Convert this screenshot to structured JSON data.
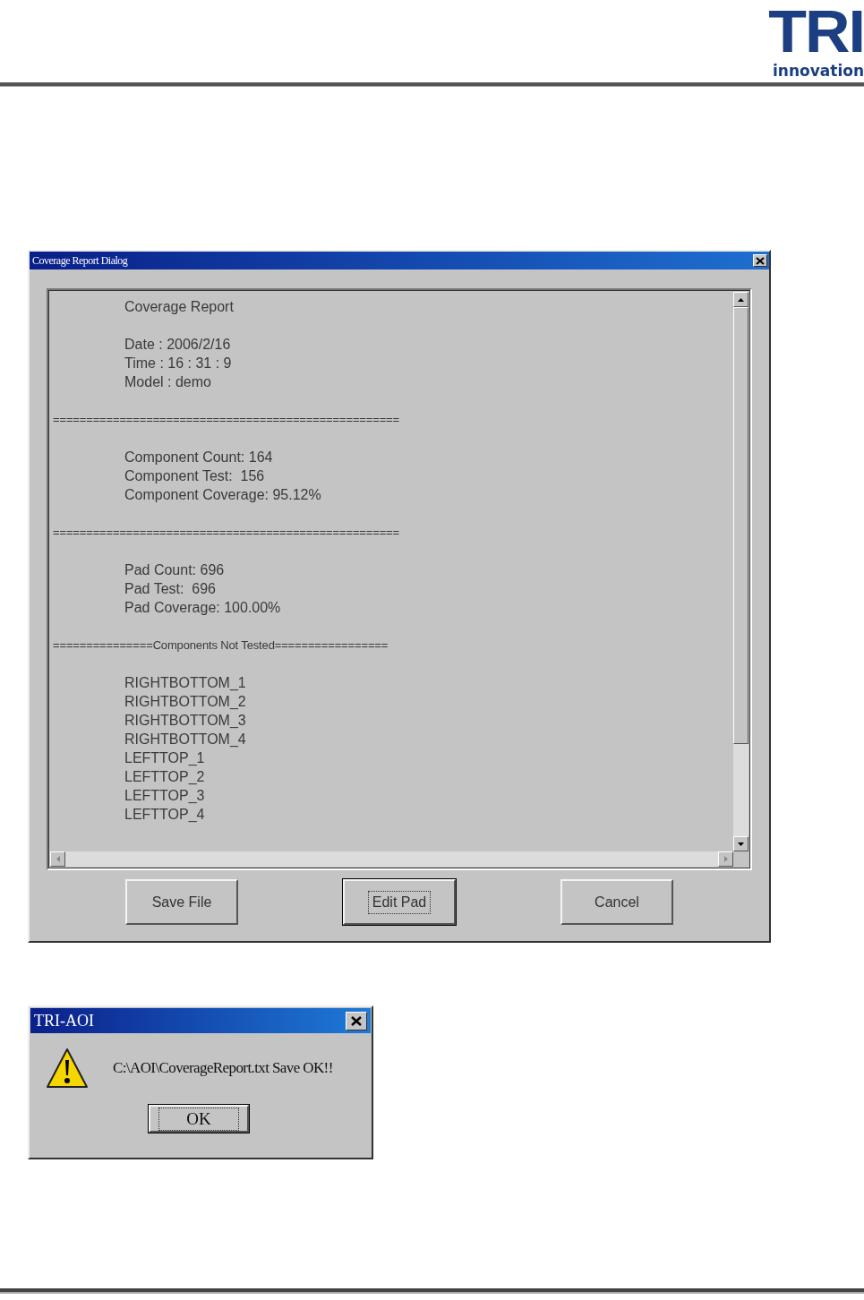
{
  "header": {
    "logo_text": "TRI",
    "logo_subtext": "innovation"
  },
  "report_dialog": {
    "title": "Coverage Report Dialog",
    "blocks": [
      {
        "kind": "text",
        "lines": [
          "Coverage Report"
        ]
      },
      {
        "kind": "text",
        "lines": [
          "Date : 2006/2/16",
          "Time : 16 : 31 : 9",
          "Model : demo"
        ]
      },
      {
        "kind": "rule",
        "text": "===================================================="
      },
      {
        "kind": "text",
        "lines": [
          "Component Count: 164",
          "Component Test:  156",
          "Component Coverage: 95.12%"
        ]
      },
      {
        "kind": "rule",
        "text": "===================================================="
      },
      {
        "kind": "text",
        "lines": [
          "Pad Count: 696",
          "Pad Test:  696",
          "Pad Coverage: 100.00%"
        ]
      },
      {
        "kind": "rule",
        "text": "===============Components Not Tested================="
      },
      {
        "kind": "text",
        "lines": [
          "RIGHTBOTTOM_1",
          "RIGHTBOTTOM_2",
          "RIGHTBOTTOM_3",
          "RIGHTBOTTOM_4",
          "LEFTTOP_1",
          "LEFTTOP_2",
          "LEFTTOP_3",
          "LEFTTOP_4"
        ]
      }
    ],
    "buttons": [
      {
        "label": "Save File",
        "default": false
      },
      {
        "label": "Edit Pad",
        "default": true
      },
      {
        "label": "Cancel",
        "default": false
      }
    ]
  },
  "message_box": {
    "title": "TRI-AOI",
    "message": "C:\\AOI\\CoverageReport.txt Save OK!!",
    "button": {
      "label": "OK",
      "default": true
    }
  }
}
